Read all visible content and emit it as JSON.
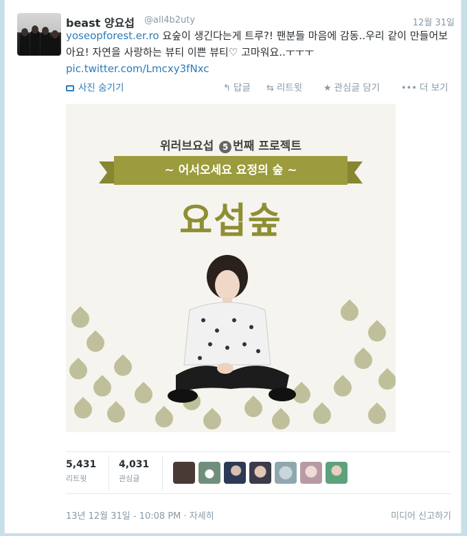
{
  "tweet": {
    "author_name": "beast 양요섭",
    "handle": "@all4b2uty",
    "date": "12월 31일",
    "link1": "yoseopforest.er.ro",
    "text1": " 요숲이 생긴다는게 트루?! 팬분들 마음에 감동..우리 같이 만들어보아요! 자연을 사랑하는 뷰티 이쁜 뷰티♡ 고마워요..ㅜㅜㅜ ",
    "link2": "pic.twitter.com/Lmcxy3fNxc"
  },
  "actions": {
    "hide_photo": "사진 숨기기",
    "reply": "답글",
    "retweet": "리트윗",
    "favorite": "관심글 담기",
    "more": "더 보기"
  },
  "photo": {
    "line1_pre": "위러브요섭",
    "line1_num": "5",
    "line1_post": "번째 프로젝트",
    "banner": "~ 어서오세요 요정의 숲 ~",
    "title": "요섭숲"
  },
  "stats": {
    "retweets_value": "5,431",
    "retweets_label": "리트윗",
    "favorites_value": "4,031",
    "favorites_label": "관심글"
  },
  "favoriters": [
    {
      "color": "#4a3a35"
    },
    {
      "color": "#6f8f7c"
    },
    {
      "color": "#2d3a55"
    },
    {
      "color": "#3b3b4a"
    },
    {
      "color": "#8fa8b0"
    },
    {
      "color": "#b89aa5"
    },
    {
      "color": "#5ea27d"
    }
  ],
  "footer": {
    "timestamp": "13년 12월 31일 - 10:08 PM",
    "details": "· 자세히",
    "report": "미디어 신고하기"
  },
  "colors": {
    "link": "#2b7bb9",
    "muted": "#8899a6",
    "olive": "#9c9b3d"
  }
}
